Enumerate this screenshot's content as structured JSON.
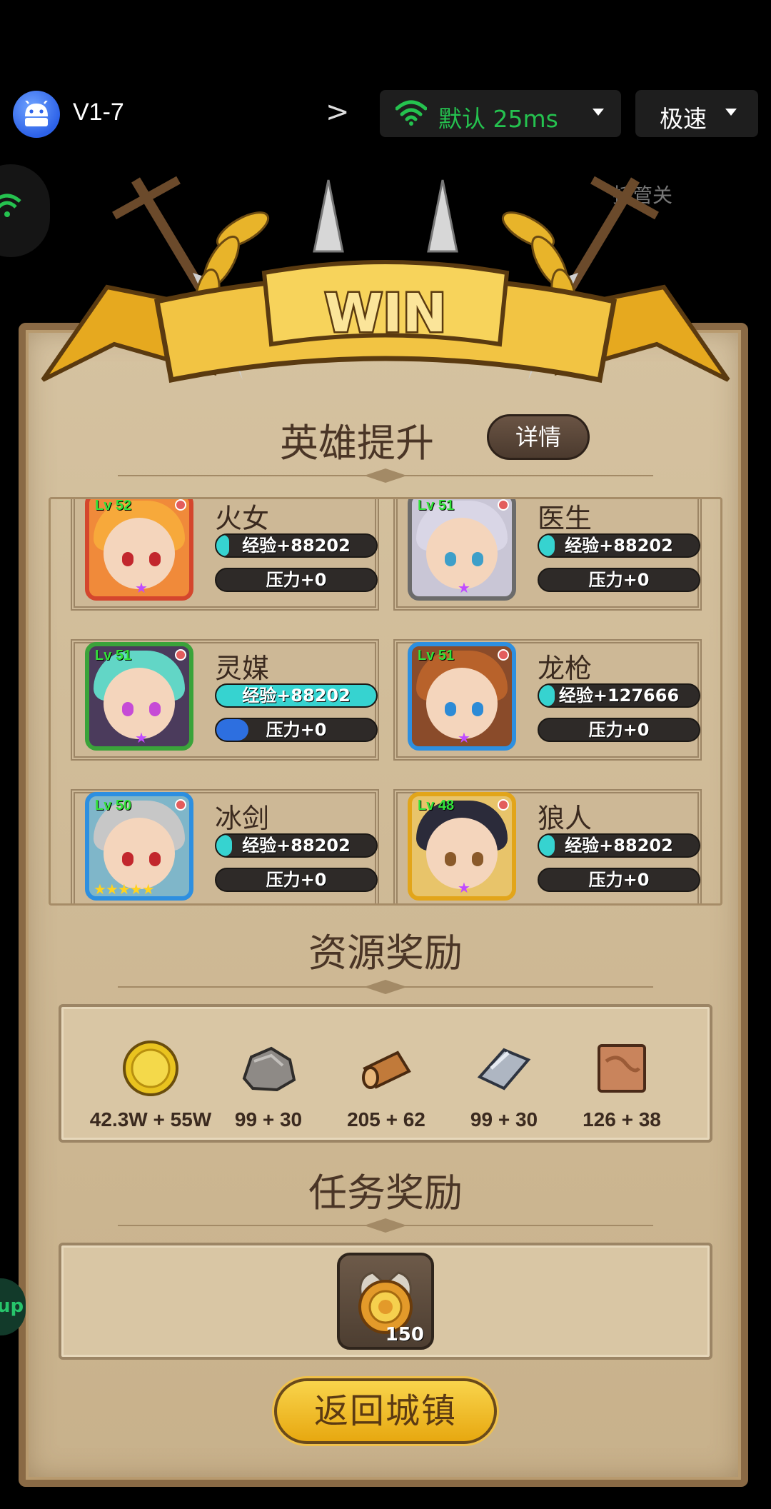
{
  "topbar": {
    "app_icon": "android-icon",
    "level_code": "V1-7",
    "chevron": "chevron-right-icon",
    "network_label": "默认 25ms",
    "speed_label": "极速",
    "network_color": "#25c24f"
  },
  "overlay": {
    "auto_label": "托管关",
    "side_badge": "up"
  },
  "banner": {
    "title": "WIN"
  },
  "hero_section": {
    "title": "英雄提升",
    "detail_button": "详情",
    "heroes": [
      {
        "name": "火女",
        "level": "Lv 52",
        "exp": "经验+88202",
        "pressure": "压力+0",
        "exp_fill": 0.08,
        "pressure_fill": 0,
        "frame_color": "#d4462d"
      },
      {
        "name": "医生",
        "level": "Lv 51",
        "exp": "经验+88202",
        "pressure": "压力+0",
        "exp_fill": 0.1,
        "pressure_fill": 0,
        "frame_color": "#6b6b6b"
      },
      {
        "name": "灵媒",
        "level": "Lv 51",
        "exp": "经验+88202",
        "pressure": "压力+0",
        "exp_fill": 1.0,
        "pressure_fill": 0.2,
        "frame_color": "#3aa33a"
      },
      {
        "name": "龙枪",
        "level": "Lv 51",
        "exp": "经验+127666",
        "pressure": "压力+0",
        "exp_fill": 0.1,
        "pressure_fill": 0,
        "frame_color": "#2d8fe0"
      },
      {
        "name": "冰剑",
        "level": "Lv 50",
        "exp": "经验+88202",
        "pressure": "压力+0",
        "exp_fill": 0.1,
        "pressure_fill": 0,
        "frame_color": "#2d8fe0"
      },
      {
        "name": "狼人",
        "level": "Lv 48",
        "exp": "经验+88202",
        "pressure": "压力+0",
        "exp_fill": 0.1,
        "pressure_fill": 0,
        "frame_color": "#e2a51a"
      }
    ]
  },
  "resource_section": {
    "title": "资源奖励",
    "items": [
      {
        "icon": "gold-coin-icon",
        "qty": "42.3W + 55W"
      },
      {
        "icon": "stone-icon",
        "qty": "99 + 30"
      },
      {
        "icon": "wood-log-icon",
        "qty": "205 + 62"
      },
      {
        "icon": "iron-ingot-icon",
        "qty": "99 + 30"
      },
      {
        "icon": "leather-icon",
        "qty": "126 + 38"
      }
    ]
  },
  "task_section": {
    "title": "任务奖励",
    "reward_icon": "medal-icon",
    "reward_qty": "150"
  },
  "footer": {
    "return_button": "返回城镇"
  }
}
